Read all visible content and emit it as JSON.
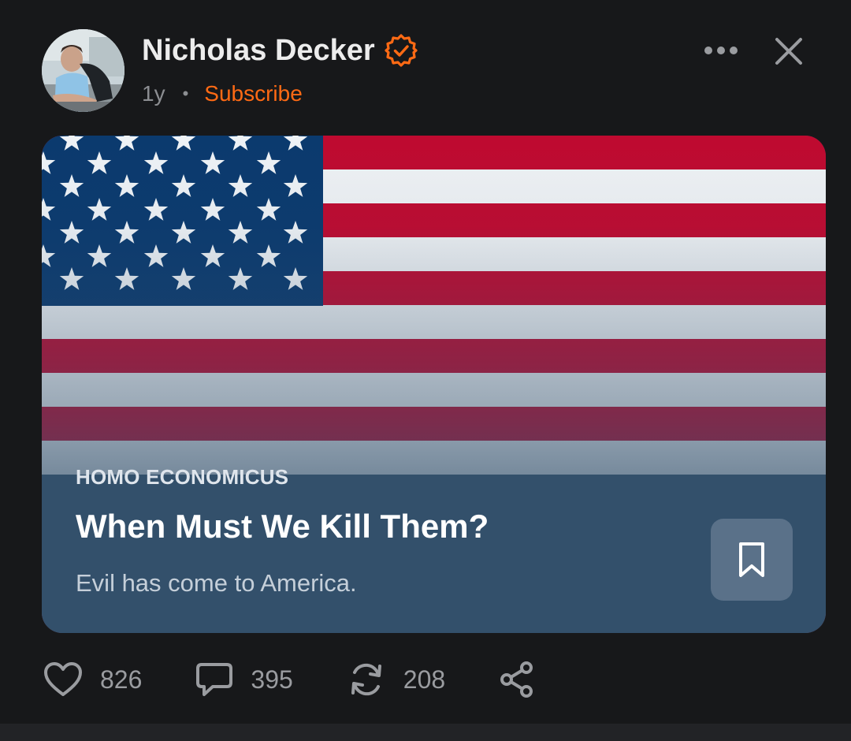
{
  "post": {
    "author": {
      "name": "Nicholas Decker",
      "verified_icon": "verified-check-icon",
      "time": "1y",
      "separator": "•",
      "subscribe_label": "Subscribe"
    },
    "menu_icons": [
      "more-dots-icon",
      "close-icon"
    ],
    "card": {
      "publication": "HOMO ECONOMICUS",
      "title": "When Must We Kill Them?",
      "subtitle": "Evil has come to America.",
      "image": "american-flag",
      "bookmark_icon": "bookmark-icon"
    },
    "actions": {
      "likes": "826",
      "comments": "395",
      "restacks": "208",
      "share_icon": "share-icon"
    }
  },
  "colors": {
    "background": "#17181a",
    "accent": "#ff6a14",
    "card_panel": "#33506b",
    "muted_text": "#9a9ca0"
  }
}
